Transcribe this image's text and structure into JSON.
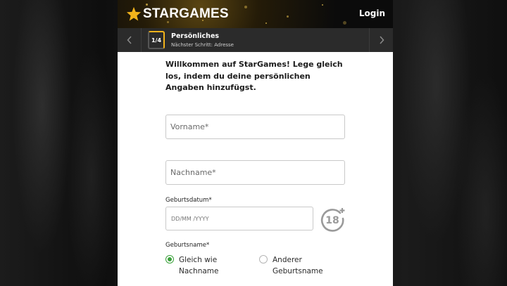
{
  "app": {
    "brand": "STARGAMES",
    "login_label": "Login",
    "accent_color": "#f2b31b"
  },
  "stepper": {
    "step_indicator": "1/4",
    "progress": 0.25,
    "title": "Persönliches",
    "next_step": "Nächster Schritt: Adresse",
    "prev_icon": "chevron-left-icon",
    "next_icon": "chevron-right-icon"
  },
  "form": {
    "welcome_text": "Willkommen auf StarGames! Lege gleich los, indem du deine persönlichen Angaben hinzufügst.",
    "first_name": {
      "placeholder": "Vorname*",
      "value": ""
    },
    "last_name": {
      "placeholder": "Nachname*",
      "value": ""
    },
    "birthdate": {
      "label": "Geburtsdatum*",
      "placeholder": "DD/MM /YYYY",
      "value": ""
    },
    "age_badge": {
      "icon": "age-18-plus-icon",
      "text": "18"
    },
    "birth_name": {
      "label": "Geburtsname*",
      "options": [
        {
          "label": "Gleich wie Nachname",
          "checked": true
        },
        {
          "label": "Anderer Geburtsname",
          "checked": false
        }
      ]
    }
  }
}
